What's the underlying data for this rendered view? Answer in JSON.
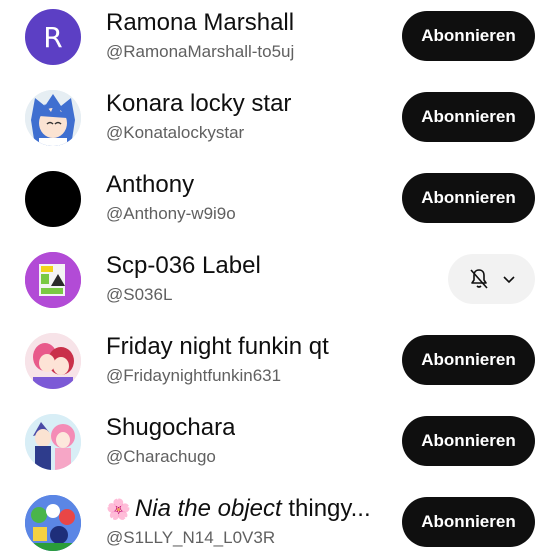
{
  "colors": {
    "button_bg": "#0f0f0f",
    "button_text": "#ffffff",
    "subscribed_bg": "#f2f2f2",
    "handle_text": "#606060"
  },
  "channels": [
    {
      "name": "Ramona Marshall",
      "handle": "@RamonaMarshall-to5uj",
      "avatar_letter": "R",
      "avatar_color": "#5c3fc4",
      "button": "Abonnieren",
      "subscribed": false
    },
    {
      "name": "Konara locky star",
      "handle": "@Konatalockystar",
      "avatar_icon": "anime-character-avatar",
      "button": "Abonnieren",
      "subscribed": false
    },
    {
      "name": "Anthony",
      "handle": "@Anthony-w9i9o",
      "avatar_color": "#000000",
      "button": "Abonnieren",
      "subscribed": false
    },
    {
      "name": "Scp-036 Label",
      "handle": "@S036L",
      "avatar_icon": "scp-label-avatar",
      "subscribed": true,
      "bell_icon": "bell-off-icon",
      "dropdown_icon": "chevron-down-icon"
    },
    {
      "name": "Friday night funkin qt",
      "handle": "@Fridaynightfunkin631",
      "avatar_icon": "anime-character-avatar",
      "button": "Abonnieren",
      "subscribed": false
    },
    {
      "name": "Shugochara",
      "handle": "@Charachugo",
      "avatar_icon": "anime-characters-avatar",
      "button": "Abonnieren",
      "subscribed": false
    },
    {
      "name_prefix": "🌸",
      "name_italic": "Nia the object",
      "name_suffix": " thingy...",
      "handle": "@S1LLY_N14_L0V3R",
      "avatar_icon": "object-show-avatar",
      "button": "Abonnieren",
      "subscribed": false
    }
  ]
}
